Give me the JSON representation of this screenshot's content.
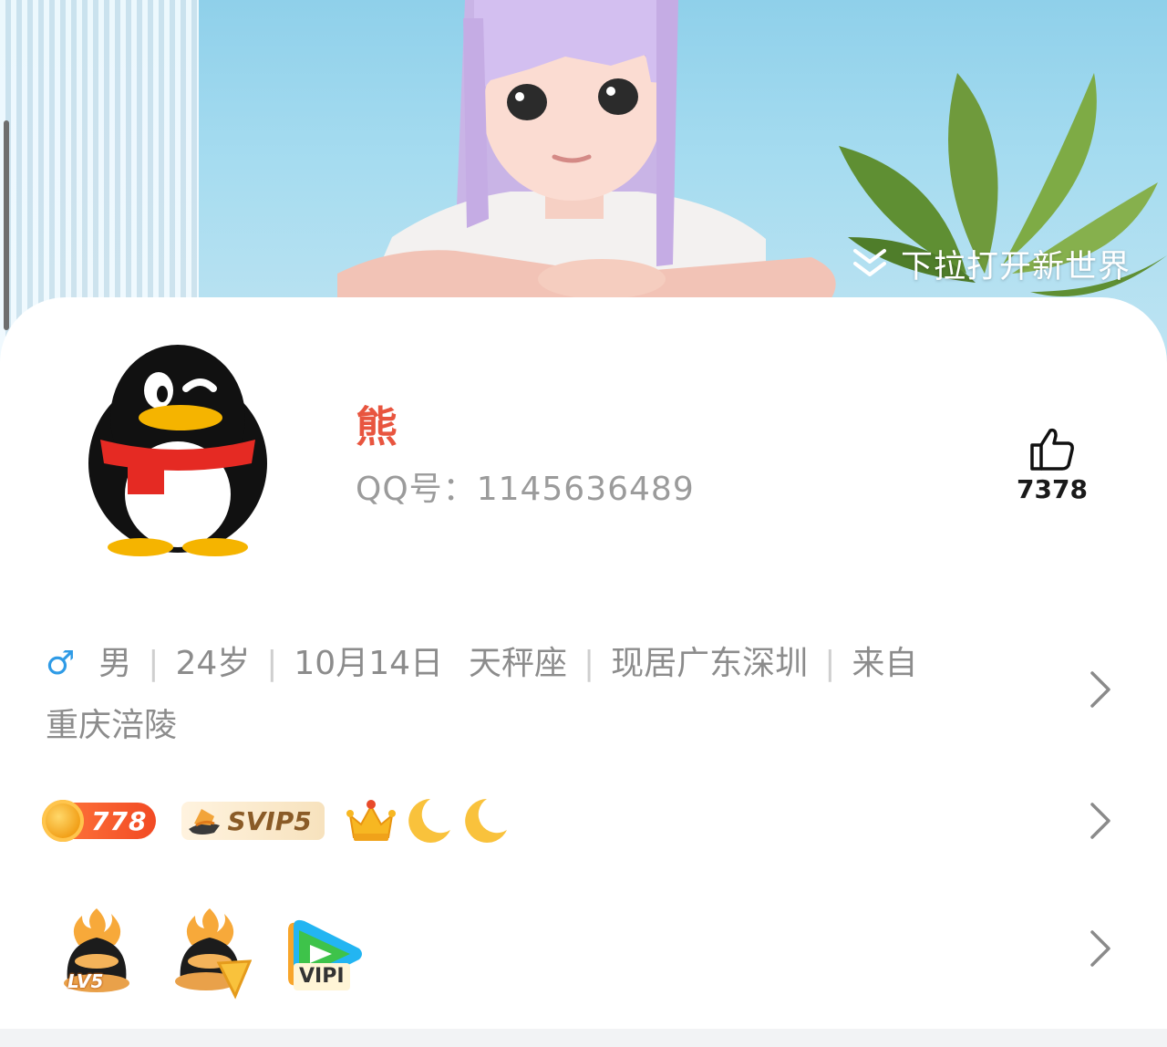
{
  "banner": {
    "pull_hint": "下拉打开新世界"
  },
  "profile": {
    "nickname": "熊",
    "qq_label": "QQ号：",
    "qq_number": "1145636489",
    "likes": "7378"
  },
  "info": {
    "gender_symbol": "♂",
    "gender": "男",
    "age": "24岁",
    "birthday": "10月14日",
    "zodiac": "天秤座",
    "residence": "现居广东深圳",
    "origin_prefix": "来自",
    "origin": "重庆涪陵"
  },
  "badges": {
    "coin_level": "778",
    "svip": "SVIP5"
  },
  "levels": {
    "lv": "LV5",
    "video_vip": "VIPI"
  },
  "colors": {
    "nickname": "#e8553f",
    "gender_male": "#2f9be6",
    "secondary_text": "#8c8c8c"
  }
}
